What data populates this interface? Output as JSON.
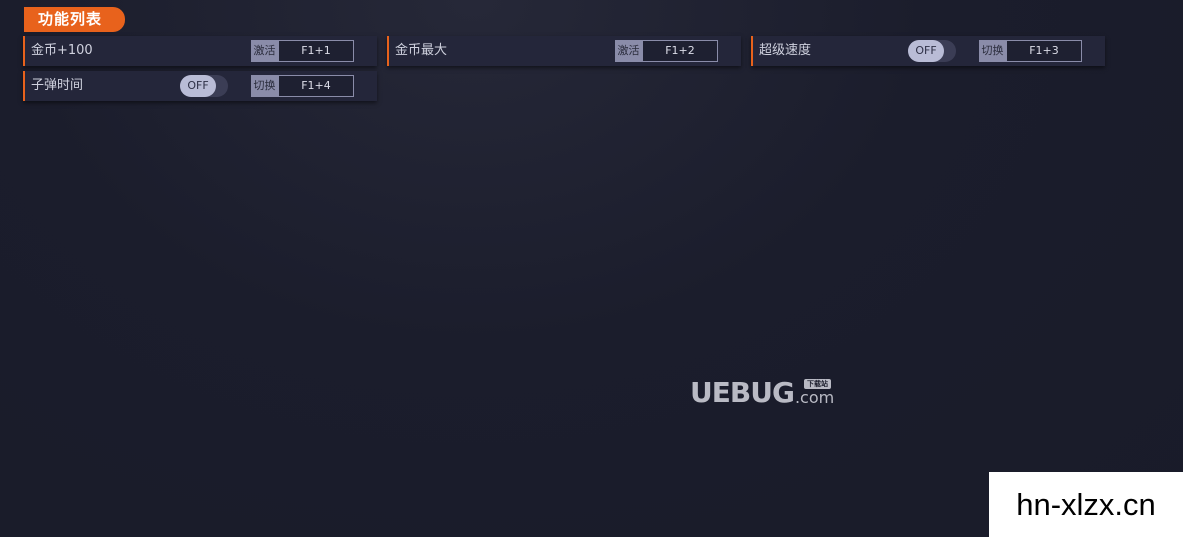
{
  "panel": {
    "title": "功能列表"
  },
  "features": [
    {
      "label": "金币+100",
      "control": "activate",
      "key_label": "激活",
      "hotkey": "F1+1"
    },
    {
      "label": "金币最大",
      "control": "activate",
      "key_label": "激活",
      "hotkey": "F1+2"
    },
    {
      "label": "超级速度",
      "control": "toggle",
      "toggle_state": "OFF",
      "key_label": "切换",
      "hotkey": "F1+3"
    },
    {
      "label": "子弹时间",
      "control": "toggle",
      "toggle_state": "OFF",
      "key_label": "切换",
      "hotkey": "F1+4"
    }
  ],
  "logo": {
    "main": "UEBUG",
    "suffix": ".com",
    "badge": "下载站"
  },
  "watermark": {
    "text": "hn-xlzx.cn"
  },
  "colors": {
    "accent": "#e8621c",
    "background": "#1a1c2b",
    "row": "#24263a",
    "key_bg": "#8a8ca9"
  }
}
